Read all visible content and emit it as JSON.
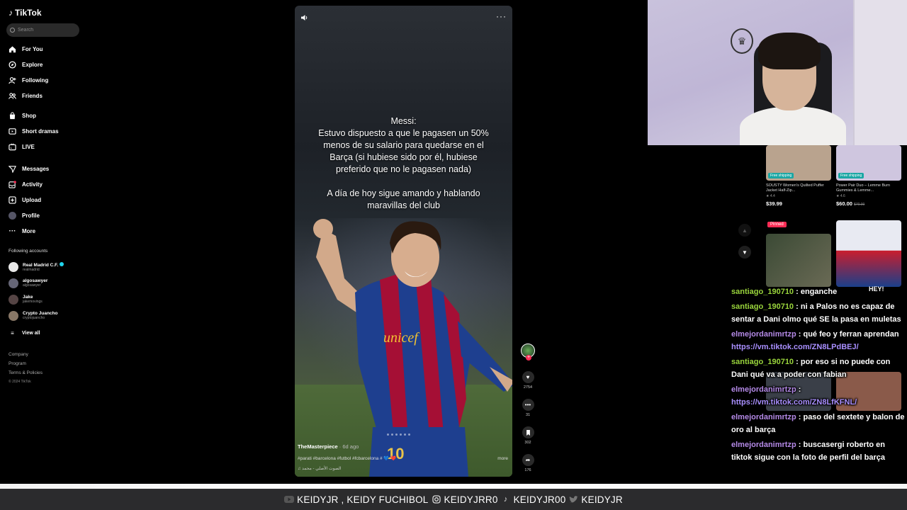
{
  "app": {
    "name": "TikTok"
  },
  "search": {
    "placeholder": "Search"
  },
  "nav": [
    {
      "label": "For You",
      "icon": "home-icon"
    },
    {
      "label": "Explore",
      "icon": "compass-icon"
    },
    {
      "label": "Following",
      "icon": "user-plus-icon"
    },
    {
      "label": "Friends",
      "icon": "friends-icon"
    },
    {
      "label": "Shop",
      "icon": "shop-bag-icon"
    },
    {
      "label": "Short dramas",
      "icon": "short-dramas-icon"
    },
    {
      "label": "LIVE",
      "icon": "live-tv-icon"
    },
    {
      "label": "Messages",
      "icon": "paper-plane-icon"
    },
    {
      "label": "Activity",
      "icon": "activity-inbox-icon"
    },
    {
      "label": "Upload",
      "icon": "upload-plus-icon"
    },
    {
      "label": "Profile",
      "icon": "profile-avatar"
    },
    {
      "label": "More",
      "icon": "ellipsis-icon"
    }
  ],
  "following": {
    "title": "Following accounts",
    "accounts": [
      {
        "name": "Real Madrid C.F.",
        "handle": "realmadrid",
        "verified": true,
        "color": "#e8e8e8"
      },
      {
        "name": "algosawyer",
        "handle": "algosawyer",
        "verified": false,
        "color": "#666677"
      },
      {
        "name": "Jake",
        "handle": "jakemovings",
        "verified": false,
        "color": "#554444"
      },
      {
        "name": "Crypto Juancho",
        "handle": "cryptojuancho",
        "verified": false,
        "color": "#887766"
      }
    ],
    "view_all": "View all"
  },
  "footer": {
    "links": [
      "Company",
      "Program",
      "Terms & Policies"
    ],
    "copyright": "© 2024 TikTok"
  },
  "video": {
    "caption_lines": [
      "Messi:",
      "Estuvo dispuesto a que le pagasen un 50%",
      "menos de su salario para quedarse en el",
      "Barça (si hubiese sido por él, hubiese",
      "preferido que no le pagasen nada)"
    ],
    "caption_extra": [
      "A día de hoy sigue amando y hablando",
      "maravillas del club"
    ],
    "author": "TheMasterpiece",
    "date": " · 6d ago",
    "tags": "#parati #barcelona #futbol #fcbarcelona # 💙 ❤️",
    "music": "♫ الصوت الأصلي - محمد",
    "more": "more",
    "jersey_sponsor": "unicef",
    "jersey_number": "10"
  },
  "actions": {
    "likes": "2754",
    "comments": "31",
    "saves": "302",
    "shares": "176"
  },
  "shop": [
    {
      "title": "SOUSTY Women's Quilted Puffer Jacket Half-Zip...",
      "rating": "4.4",
      "price": "$39.99",
      "old_price": "",
      "badge": "Free shipping",
      "color": "#b9a38e"
    },
    {
      "title": "Power Pair Duo – Lemme Burn Gummies & Lemme...",
      "rating": "4.6",
      "price": "$60.00",
      "old_price": "$70.00",
      "badge": "Free shipping",
      "color": "#cfc6df"
    }
  ],
  "pinned_label": "Pinned",
  "thumb_text": "HEY!",
  "chat": [
    {
      "user": "santiago_190710",
      "color": "green",
      "text": "enganche",
      "link": ""
    },
    {
      "user": "santiago_190710",
      "color": "green",
      "text": "ni a Palos no es capaz de sentar a Dani olmo qué SE la pasa en muletas",
      "link": ""
    },
    {
      "user": "elmejordanimrtzp",
      "color": "purple",
      "text": "qué feo y ferran aprendan",
      "link": "https://vm.tiktok.com/ZN8LPdBEJ/"
    },
    {
      "user": "santiago_190710",
      "color": "green",
      "text": "por eso si no puede con Dani qué va a poder con fabian",
      "link": ""
    },
    {
      "user": "elmejordanimrtzp",
      "color": "purple",
      "text": "",
      "link": "https://vm.tiktok.com/ZN8LfKFNL/"
    },
    {
      "user": "elmejordanimrtzp",
      "color": "purple",
      "text": "paso del sextete y balon de oro al barça",
      "link": ""
    },
    {
      "user": "elmejordanimrtzp",
      "color": "purple",
      "text": "buscasergi roberto en tiktok sigue con la foto de perfil del barça",
      "link": ""
    }
  ],
  "banner": {
    "yt": "KEIDYJR , KEIDY FUCHIBOL",
    "ig": "KEIDYJRR0",
    "tt": "KEIDYJR00",
    "tw": "KEIDYJR"
  }
}
